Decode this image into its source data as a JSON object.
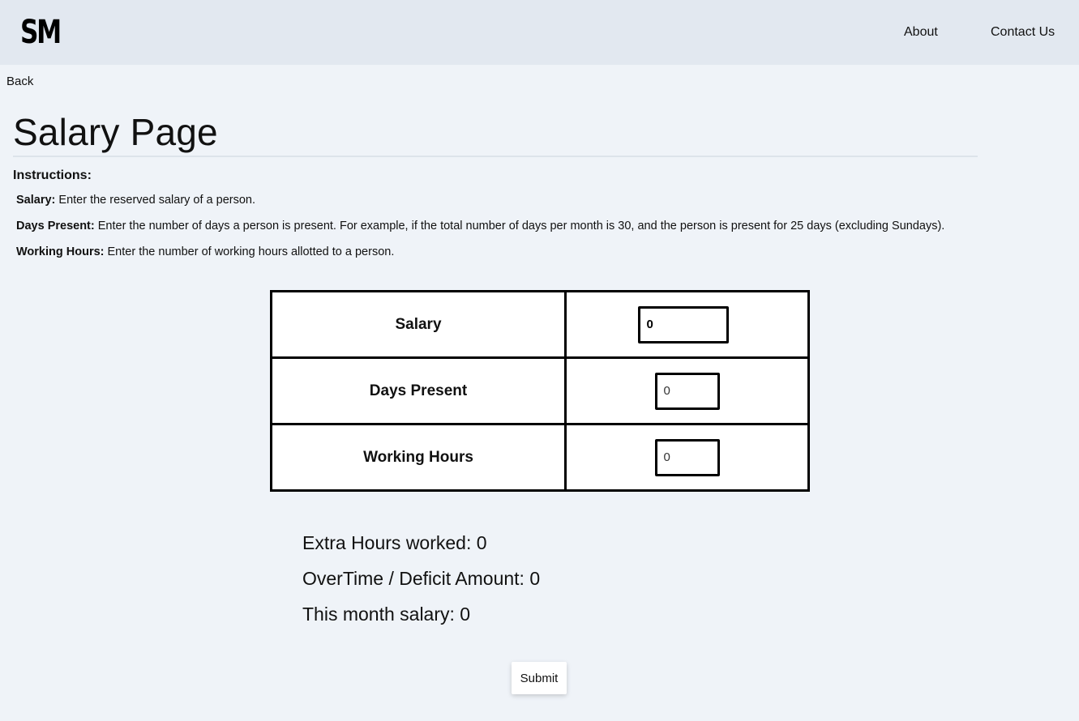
{
  "header": {
    "logo": "SM",
    "nav": [
      {
        "label": "About"
      },
      {
        "label": "Contact Us"
      }
    ]
  },
  "back_label": "Back",
  "page_title": "Salary Page",
  "instructions": {
    "heading": "Instructions:",
    "items": [
      {
        "term": "Salary:",
        "text": " Enter the reserved salary of a person."
      },
      {
        "term": "Days Present:",
        "text": " Enter the number of days a person is present. For example, if the total number of days per month is 30, and the person is present for 25 days (excluding Sundays)."
      },
      {
        "term": "Working Hours:",
        "text": " Enter the number of working hours allotted to a person."
      }
    ]
  },
  "form": {
    "rows": [
      {
        "label": "Salary",
        "value": "0"
      },
      {
        "label": "Days Present",
        "value": "0"
      },
      {
        "label": "Working Hours",
        "value": "0"
      }
    ]
  },
  "results": {
    "extra_hours": "Extra Hours worked: 0",
    "overtime": "OverTime / Deficit Amount: 0",
    "month_salary": "This month salary: 0"
  },
  "submit_label": "Submit"
}
